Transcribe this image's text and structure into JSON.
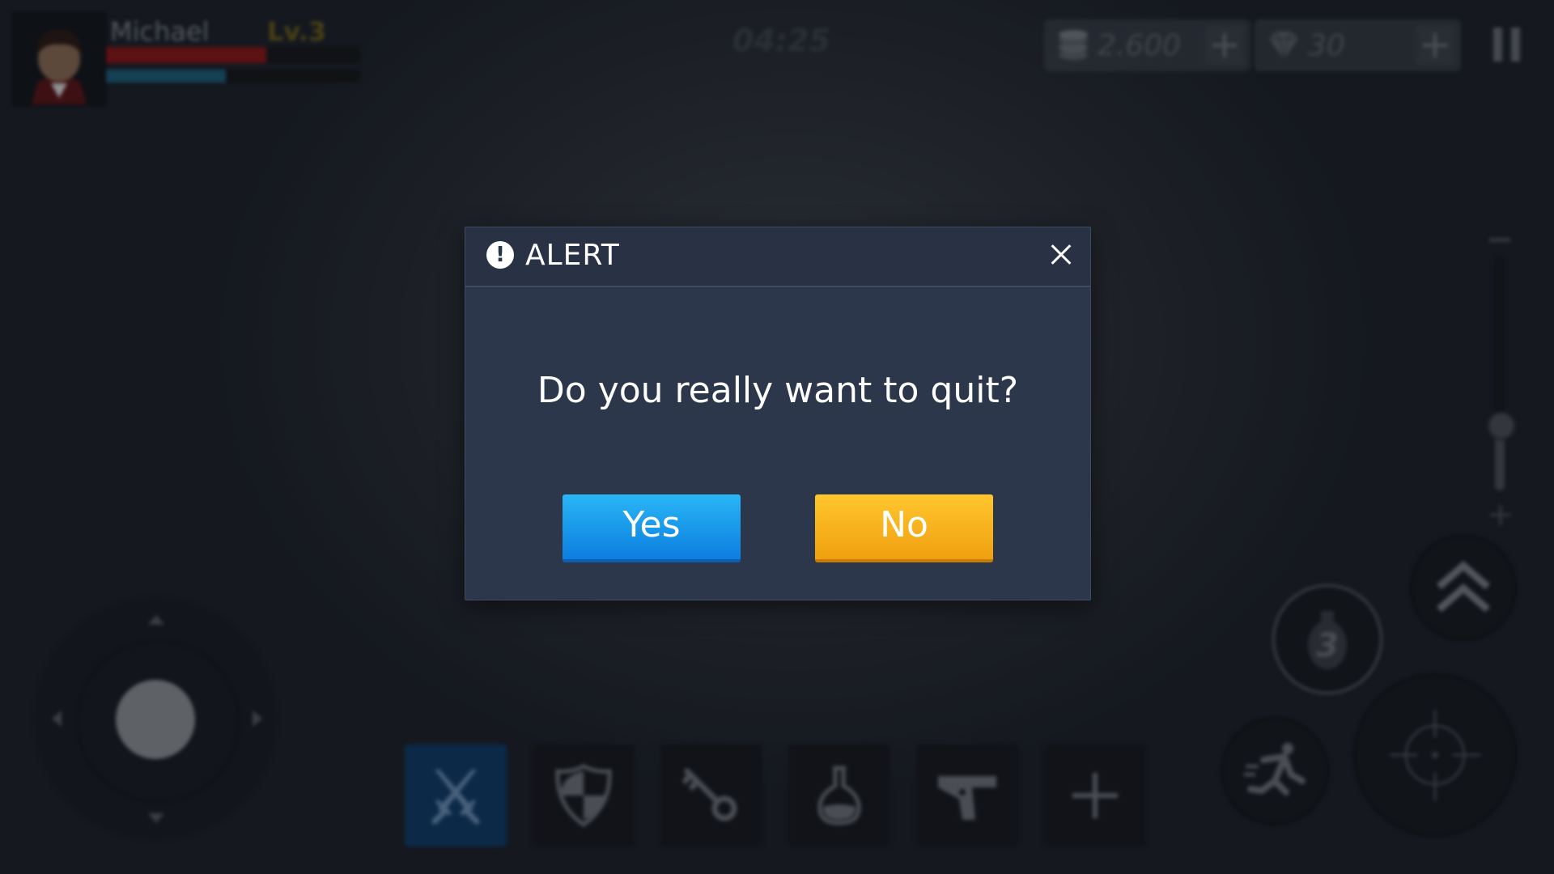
{
  "hud": {
    "player_name": "Michael",
    "player_level": "Lv.3",
    "hp_fraction": 0.63,
    "mp_fraction": 0.47,
    "timer": "04:25",
    "coins": "2.600",
    "gems": "30",
    "coins_plus": "+",
    "gems_plus": "+",
    "zoom_minus": "−",
    "zoom_plus": "+",
    "zoom_level_fraction": 0.3,
    "grenade_count": "3"
  },
  "items": [
    {
      "icon": "crossed-swords-icon",
      "active": true
    },
    {
      "icon": "shield-icon",
      "active": false
    },
    {
      "icon": "key-icon",
      "active": false
    },
    {
      "icon": "potion-flask-icon",
      "active": false
    },
    {
      "icon": "pistol-icon",
      "active": false
    },
    {
      "icon": "add-slot-icon",
      "active": false
    }
  ],
  "dialog": {
    "title": "ALERT",
    "icon": "!",
    "message": "Do you really want to quit?",
    "yes_label": "Yes",
    "no_label": "No"
  },
  "colors": {
    "dialog_bg": "#2c374b",
    "yes_button": "#1a8ff0",
    "no_button": "#f5b01f",
    "hp_bar": "#8a1616",
    "mp_bar": "#1d5d7a",
    "selected_slot": "#0f3a66"
  }
}
